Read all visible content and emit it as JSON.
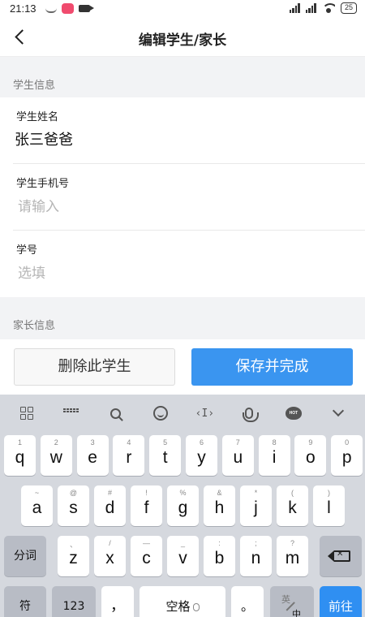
{
  "status_bar": {
    "time": "21:13",
    "battery": "25"
  },
  "nav": {
    "title": "编辑学生/家长"
  },
  "student_section": {
    "header": "学生信息",
    "fields": [
      {
        "label": "学生姓名",
        "value": "张三爸爸",
        "placeholder": ""
      },
      {
        "label": "学生手机号",
        "value": "",
        "placeholder": "请输入"
      },
      {
        "label": "学号",
        "value": "",
        "placeholder": "选填"
      }
    ]
  },
  "parent_section": {
    "header": "家长信息"
  },
  "actions": {
    "delete_label": "删除此学生",
    "save_label": "保存并完成"
  },
  "keyboard": {
    "toolbar_icons": [
      "grid-icon",
      "keyboard-icon",
      "search-icon",
      "emoji-icon",
      "cursor-icon",
      "voice-icon",
      "hot-icon",
      "collapse-icon"
    ],
    "hot_badge": "HOT",
    "cursor_glyph": "‹I›",
    "row1": [
      {
        "hint": "1",
        "key": "q"
      },
      {
        "hint": "2",
        "key": "w"
      },
      {
        "hint": "3",
        "key": "e"
      },
      {
        "hint": "4",
        "key": "r"
      },
      {
        "hint": "5",
        "key": "t"
      },
      {
        "hint": "6",
        "key": "y"
      },
      {
        "hint": "7",
        "key": "u"
      },
      {
        "hint": "8",
        "key": "i"
      },
      {
        "hint": "9",
        "key": "o"
      },
      {
        "hint": "0",
        "key": "p"
      }
    ],
    "row2": [
      {
        "hint": "~",
        "key": "a"
      },
      {
        "hint": "@",
        "key": "s"
      },
      {
        "hint": "#",
        "key": "d"
      },
      {
        "hint": "!",
        "key": "f"
      },
      {
        "hint": "%",
        "key": "g"
      },
      {
        "hint": "&",
        "key": "h"
      },
      {
        "hint": "*",
        "key": "j"
      },
      {
        "hint": "(",
        "key": "k"
      },
      {
        "hint": ")",
        "key": "l"
      }
    ],
    "row3": [
      {
        "hint": "、",
        "key": "z"
      },
      {
        "hint": "/",
        "key": "x"
      },
      {
        "hint": "—",
        "key": "c"
      },
      {
        "hint": "_",
        "key": "v"
      },
      {
        "hint": ":",
        "key": "b"
      },
      {
        "hint": ";",
        "key": "n"
      },
      {
        "hint": "?",
        "key": "m"
      }
    ],
    "segment_label": "分词",
    "symbols_label": "符",
    "numbers_label": "123",
    "comma_label": "，",
    "space_label": "空格",
    "period_label": "。",
    "lang_top": "英",
    "lang_bottom": "中",
    "go_label": "前往"
  }
}
